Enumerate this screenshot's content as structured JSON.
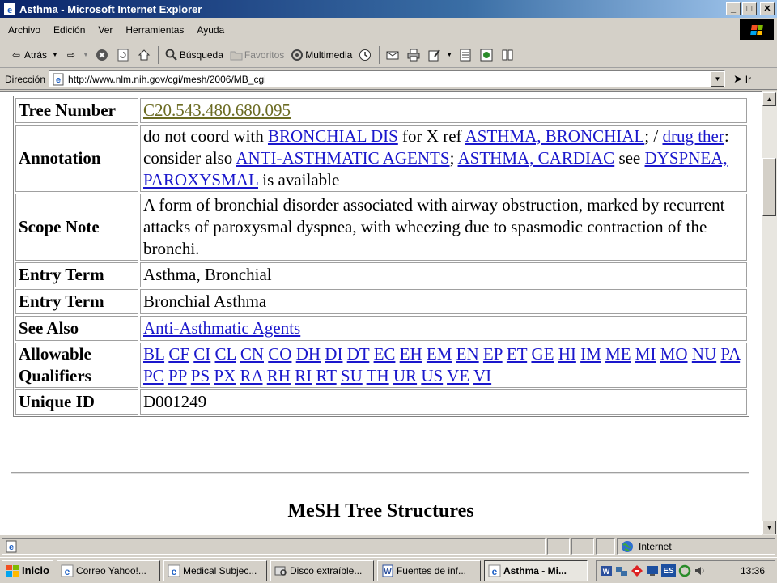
{
  "window": {
    "title": "Asthma - Microsoft Internet Explorer"
  },
  "menu": [
    "Archivo",
    "Edición",
    "Ver",
    "Herramientas",
    "Ayuda"
  ],
  "toolbar": {
    "back": "Atrás",
    "search": "Búsqueda",
    "favorites": "Favoritos",
    "multimedia": "Multimedia"
  },
  "address": {
    "label": "Dirección",
    "url": "http://www.nlm.nih.gov/cgi/mesh/2006/MB_cgi",
    "go": "Ir"
  },
  "record": {
    "tree_number": {
      "label": "Tree Number",
      "value": "C20.543.480.680.095"
    },
    "annotation": {
      "label": "Annotation",
      "parts": {
        "t1": "do not coord with ",
        "l1": "BRONCHIAL DIS",
        "t2": " for X ref ",
        "l2": "ASTHMA, BRONCHIAL",
        "t3": "; / ",
        "l3": "drug ther",
        "t4": ": consider also ",
        "l4": "ANTI-ASTHMATIC AGENTS",
        "t5": "; ",
        "l5": "ASTHMA, CARDIAC",
        "t6": " see ",
        "l6": "DYSPNEA, PAROXYSMAL",
        "t7": " is available"
      }
    },
    "scope_note": {
      "label": "Scope Note",
      "value": "A form of bronchial disorder associated with airway obstruction, marked by recurrent attacks of paroxysmal dyspnea, with wheezing due to spasmodic contraction of the bronchi."
    },
    "entry_terms": [
      {
        "label": "Entry Term",
        "value": "Asthma, Bronchial"
      },
      {
        "label": "Entry Term",
        "value": "Bronchial Asthma"
      }
    ],
    "see_also": {
      "label": "See Also",
      "value": "Anti-Asthmatic Agents"
    },
    "qualifiers": {
      "label": "Allowable Qualifiers",
      "values": [
        "BL",
        "CF",
        "CI",
        "CL",
        "CN",
        "CO",
        "DH",
        "DI",
        "DT",
        "EC",
        "EH",
        "EM",
        "EN",
        "EP",
        "ET",
        "GE",
        "HI",
        "IM",
        "ME",
        "MI",
        "MO",
        "NU",
        "PA",
        "PC",
        "PP",
        "PS",
        "PX",
        "RA",
        "RH",
        "RI",
        "RT",
        "SU",
        "TH",
        "UR",
        "US",
        "VE",
        "VI"
      ]
    },
    "unique_id": {
      "label": "Unique ID",
      "value": "D001249"
    }
  },
  "section_title": "MeSH Tree Structures",
  "status": {
    "zone": "Internet"
  },
  "taskbar": {
    "start": "Inicio",
    "tasks": [
      "Correo Yahoo!...",
      "Medical Subjec...",
      "Disco extraíble...",
      "Fuentes de inf...",
      "Asthma - Mi..."
    ],
    "clock": "13:36",
    "lang": "ES"
  },
  "colors": {
    "link": "#1a17cc",
    "visited_link": "#6b6b22",
    "titlebar": "#0a246a"
  }
}
